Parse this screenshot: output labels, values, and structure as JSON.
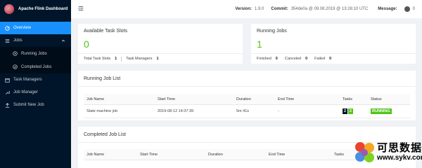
{
  "app": {
    "title": "Apache Flink Dashboard"
  },
  "sidebar": {
    "items": [
      {
        "label": "Overview",
        "icon": "dashboard-icon"
      },
      {
        "label": "Jobs",
        "icon": "unordered-list-icon"
      },
      {
        "label": "Running Jobs",
        "icon": "play-circle-icon"
      },
      {
        "label": "Completed Jobs",
        "icon": "check-circle-icon"
      },
      {
        "label": "Task Managers",
        "icon": "schedule-icon"
      },
      {
        "label": "Job Manager",
        "icon": "build-icon"
      },
      {
        "label": "Submit New Job",
        "icon": "upload-icon"
      }
    ]
  },
  "header": {
    "version_label": "Version:",
    "version_value": "1.9.0",
    "commit_label": "Commit:",
    "commit_value": "354de0a @ 09.08.2019 @ 13:28:10 UTC",
    "message_label": "Message:",
    "message_count": "0"
  },
  "slots": {
    "title": "Available Task Slots",
    "value": "0",
    "total_label": "Total Task Slots",
    "total_value": "1",
    "tm_label": "Task Managers",
    "tm_value": "1"
  },
  "running": {
    "title": "Running Jobs",
    "value": "1",
    "finished_label": "Finished",
    "finished_value": "0",
    "canceled_label": "Canceled",
    "canceled_value": "0",
    "failed_label": "Failed",
    "failed_value": "0"
  },
  "running_list": {
    "title": "Running Job List",
    "columns": [
      "Job Name",
      "Start Time",
      "Duration",
      "End Time",
      "Tasks",
      "Status"
    ],
    "rows": [
      {
        "name": "State machine job",
        "start": "2019-08-12 14:37:39",
        "duration": "5m 41s",
        "end": "-",
        "task_a": "2",
        "task_b": "2",
        "status": "RUNNING"
      }
    ]
  },
  "completed_list": {
    "title": "Completed Job List",
    "columns": [
      "Job Name",
      "Start Time",
      "Duration",
      "End Time",
      "Tasks"
    ]
  },
  "watermark": {
    "text": "可思数据",
    "url": "www.sykv.com"
  },
  "colors": {
    "accent": "#1890ff",
    "running": "#52c41a",
    "sidebar": "#001529"
  }
}
